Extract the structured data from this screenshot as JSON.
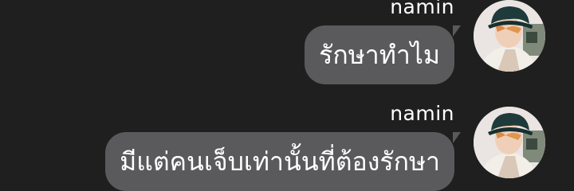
{
  "messages": [
    {
      "sender": "namin",
      "text": "รักษาทำไม",
      "avatar_icon": "user-avatar"
    },
    {
      "sender": "namin",
      "text": "มีแต่คนเจ็บเท่านั้นที่ต้องรักษา",
      "avatar_icon": "user-avatar"
    }
  ],
  "colors": {
    "background": "#1f1f1f",
    "bubble": "#5a5a5c",
    "text": "#ffffff"
  }
}
